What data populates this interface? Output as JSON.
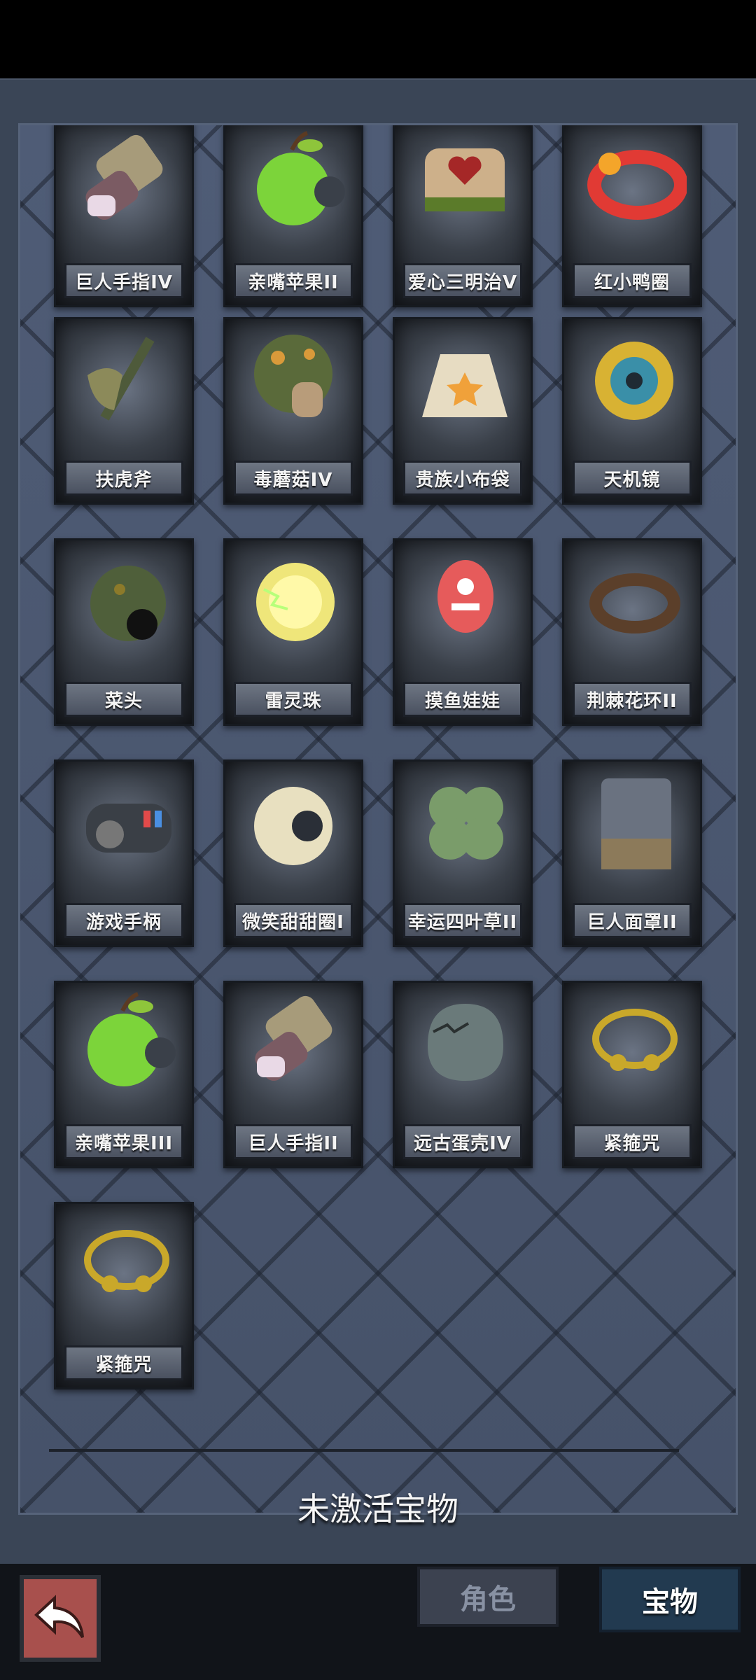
{
  "items": [
    {
      "label": "巨人手指IV",
      "icon": "giant-finger-icon"
    },
    {
      "label": "亲嘴苹果II",
      "icon": "bitten-apple-icon"
    },
    {
      "label": "爱心三明治V",
      "icon": "heart-sandwich-icon"
    },
    {
      "label": "红小鸭圈",
      "icon": "red-duck-float-icon"
    },
    {
      "label": "扶虎斧",
      "icon": "axe-icon"
    },
    {
      "label": "毒蘑菇IV",
      "icon": "poison-mushroom-icon"
    },
    {
      "label": "贵族小布袋",
      "icon": "cloth-bag-icon"
    },
    {
      "label": "天机镜",
      "icon": "bagua-mirror-icon"
    },
    {
      "label": "菜头",
      "icon": "spiky-head-icon"
    },
    {
      "label": "雷灵珠",
      "icon": "thunder-orb-icon"
    },
    {
      "label": "摸鱼娃娃",
      "icon": "pink-doll-icon"
    },
    {
      "label": "荆棘花环II",
      "icon": "thorn-wreath-icon"
    },
    {
      "label": "游戏手柄",
      "icon": "gamepad-icon"
    },
    {
      "label": "微笑甜甜圈I",
      "icon": "smile-donut-icon"
    },
    {
      "label": "幸运四叶草II",
      "icon": "four-leaf-clover-icon"
    },
    {
      "label": "巨人面罩II",
      "icon": "giant-mask-icon"
    },
    {
      "label": "亲嘴苹果III",
      "icon": "bitten-apple-icon"
    },
    {
      "label": "巨人手指II",
      "icon": "giant-finger-icon"
    },
    {
      "label": "远古蛋壳IV",
      "icon": "ancient-eggshell-icon"
    },
    {
      "label": "紧箍咒",
      "icon": "golden-headband-icon"
    },
    {
      "label": "紧箍咒",
      "icon": "golden-headband-icon"
    }
  ],
  "inactive_section": {
    "title": "未激活宝物"
  },
  "nav": {
    "back_icon": "back-arrow-icon",
    "tabs": [
      {
        "label": "角色",
        "active": false
      },
      {
        "label": "宝物",
        "active": true
      }
    ]
  }
}
